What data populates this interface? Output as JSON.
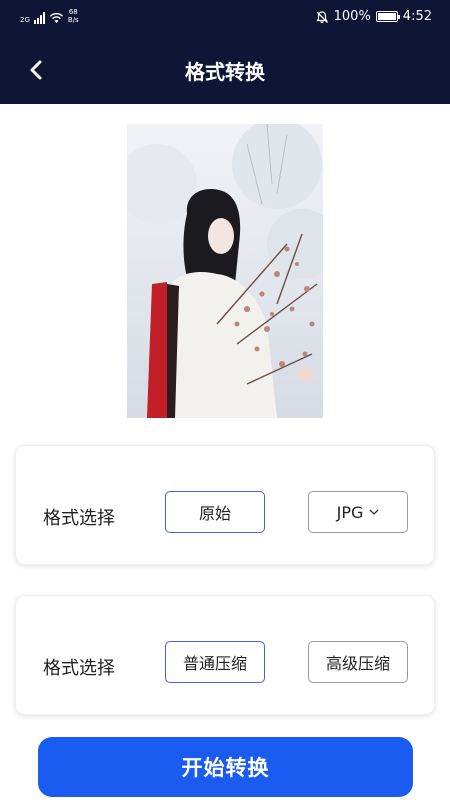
{
  "status_bar": {
    "signal_tag": "2G",
    "net_speed_value": "68",
    "net_speed_unit": "B/s",
    "battery_percent": "100%",
    "time": "4:52"
  },
  "nav": {
    "title": "格式转换",
    "back_icon": "chevron-left-icon"
  },
  "photo": {
    "description_icon": "image-preview"
  },
  "format_card": {
    "label": "格式选择",
    "option_original": "原始",
    "format_dropdown": "JPG",
    "dropdown_icon": "chevron-down-icon"
  },
  "compress_card": {
    "label": "格式选择",
    "option_normal": "普通压缩",
    "option_advanced": "高级压缩"
  },
  "action": {
    "start_label": "开始转换"
  },
  "colors": {
    "header_bg": "#0f1535",
    "accent": "#1a5cf2",
    "selected_border": "#4168d8"
  }
}
